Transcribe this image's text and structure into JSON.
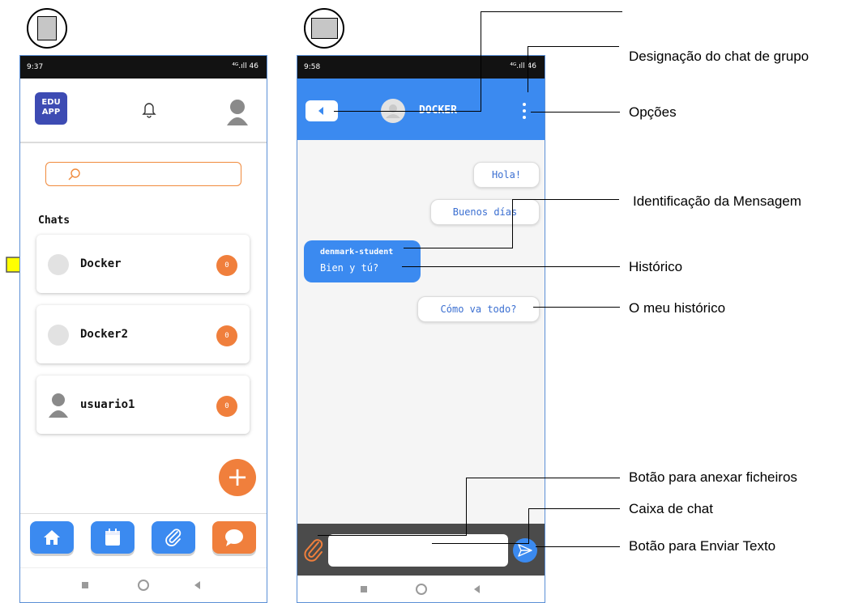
{
  "markers": [
    "",
    ""
  ],
  "phone1": {
    "status_time": "9:37",
    "status_icons": "⁴ᴳ.ıll 46",
    "logo_text": "EDU APP",
    "search_placeholder": "",
    "section_title": "Chats",
    "chats": [
      {
        "name": "Docker",
        "badge": "0"
      },
      {
        "name": "Docker2",
        "badge": "0"
      },
      {
        "name": "usuario1",
        "badge": "0"
      }
    ],
    "fab_label": "+",
    "tabs": [
      "home-icon",
      "calendar-icon",
      "attach-icon",
      "chat-icon"
    ]
  },
  "phone2": {
    "status_time": "9:58",
    "status_icons": "⁴ᴳ.ıll 46",
    "chat_title": "DOCKER",
    "messages": [
      {
        "type": "out",
        "text": "Hola!"
      },
      {
        "type": "out",
        "text": "Buenos días"
      },
      {
        "type": "in",
        "sender": "denmark-student",
        "text": "Bien y tú?"
      },
      {
        "type": "out",
        "text": "Cómo va todo?"
      }
    ],
    "message_input_value": ""
  },
  "callouts": {
    "group_chat_name": "Designação  do chat de grupo",
    "options": "Opções",
    "message_id": "Identificação da Mensagem",
    "history": "Histórico",
    "my_history": "O meu histórico",
    "attach_button": "Botão para anexar  ficheiros",
    "chat_box": "Caixa de chat",
    "send_button": "Botão para Enviar Texto"
  },
  "colors": {
    "accent_blue": "#3b8af0",
    "accent_orange": "#f07f3c",
    "arrow_yellow": "#ffff00",
    "status_bar": "#121212"
  }
}
